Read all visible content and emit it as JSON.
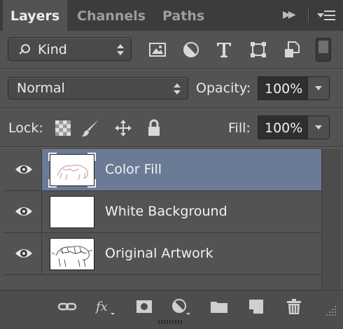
{
  "tabs": [
    {
      "label": "Layers",
      "active": true
    },
    {
      "label": "Channels",
      "active": false
    },
    {
      "label": "Paths",
      "active": false
    }
  ],
  "filter": {
    "kind_label": "Kind",
    "icons": [
      "pixel-layer-filter-icon",
      "adjustment-layer-filter-icon",
      "type-layer-filter-icon",
      "shape-layer-filter-icon",
      "smart-object-filter-icon"
    ]
  },
  "blend": {
    "mode": "Normal",
    "opacity_label": "Opacity:",
    "opacity_value": "100%"
  },
  "lock": {
    "label": "Lock:",
    "icons": [
      "lock-transparent-pixels-icon",
      "lock-image-pixels-icon",
      "lock-position-icon",
      "lock-all-icon"
    ],
    "fill_label": "Fill:",
    "fill_value": "100%"
  },
  "layers": [
    {
      "name": "Color Fill",
      "selected": true,
      "visible": true,
      "thumb": "transparent-with-red-sketch"
    },
    {
      "name": "White Background",
      "selected": false,
      "visible": true,
      "thumb": "white"
    },
    {
      "name": "Original Artwork",
      "selected": false,
      "visible": true,
      "thumb": "sketch"
    }
  ],
  "bottom_icons": [
    "link-layers-icon",
    "layer-style-icon",
    "add-mask-icon",
    "adjustment-layer-icon",
    "new-group-icon",
    "new-layer-icon",
    "delete-layer-icon"
  ],
  "colors": {
    "panel": "#535353",
    "tabbar": "#3c3c3c",
    "selected_layer": "#6b7b96"
  }
}
